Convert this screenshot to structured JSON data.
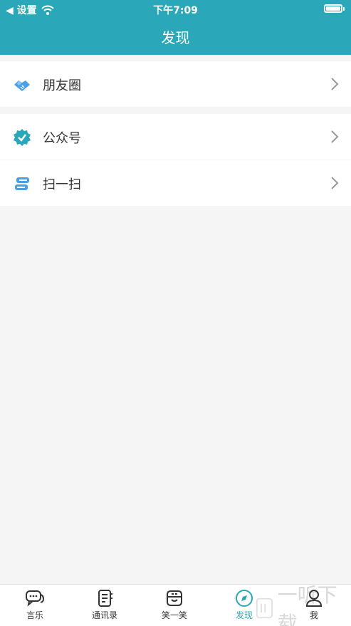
{
  "status_bar": {
    "back_label": "◀ 设置",
    "time": "下午7:09"
  },
  "header": {
    "title": "发现"
  },
  "list": [
    {
      "label": "朋友圈",
      "icon": "handshake-icon"
    },
    {
      "label": "公众号",
      "icon": "verified-badge-icon"
    },
    {
      "label": "扫一扫",
      "icon": "scan-icon"
    }
  ],
  "tabbar": {
    "tabs": [
      {
        "label": "言乐",
        "icon": "chat-bubbles-icon"
      },
      {
        "label": "通讯录",
        "icon": "contacts-book-icon"
      },
      {
        "label": "笑一笑",
        "icon": "smile-box-icon"
      },
      {
        "label": "发现",
        "icon": "compass-icon"
      },
      {
        "label": "我",
        "icon": "person-icon"
      }
    ],
    "active": "发现"
  },
  "watermark": {
    "text": "一听下载"
  },
  "colors": {
    "accent": "#2aa7b8",
    "background": "#f5f5f5"
  }
}
